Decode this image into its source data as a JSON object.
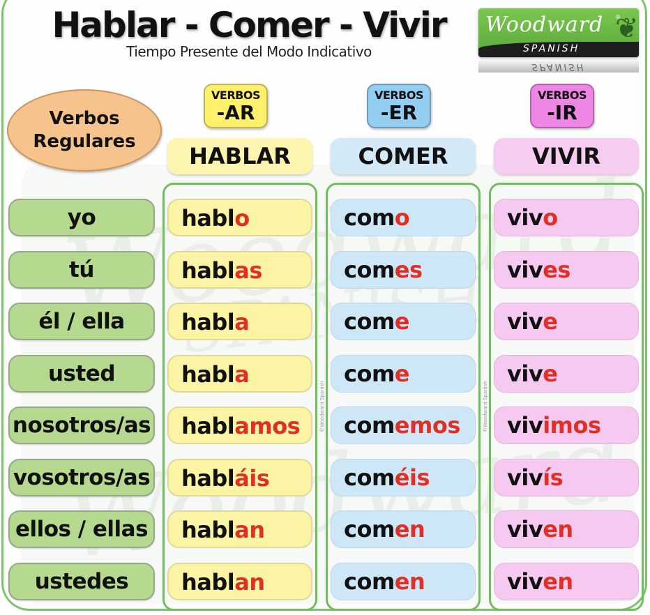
{
  "header": {
    "title": "Hablar - Comer - Vivir",
    "subtitle": "Tiempo Presente del Modo Indicativo"
  },
  "logo": {
    "brand": "Woodward",
    "registered": "®",
    "sub": "SPANISH",
    "reflection": "SPANISH"
  },
  "category": {
    "line1": "Verbos",
    "line2": "Regulares"
  },
  "colors": {
    "ar": "#fbf4a4",
    "er": "#cde7f6",
    "ir": "#f6c9f1",
    "pronoun": "#b5d98f",
    "ending": "#e03026",
    "border": "#6fbf5c"
  },
  "columns": [
    {
      "tag_top": "VERBOS",
      "tag_bottom": "-AR",
      "tag_color": "#fdf06b",
      "verb": "HABLAR",
      "verb_bg": "#fcf5b0",
      "copyright": "©Woodward Spanish"
    },
    {
      "tag_top": "VERBOS",
      "tag_bottom": "-ER",
      "tag_color": "#94cdf2",
      "verb": "COMER",
      "verb_bg": "#d3e9f7",
      "copyright": "©Woodward Spanish"
    },
    {
      "tag_top": "VERBOS",
      "tag_bottom": "-IR",
      "tag_color": "#ee86e4",
      "verb": "VIVIR",
      "verb_bg": "#f6cdf1"
    }
  ],
  "rows": [
    {
      "pronoun": "yo",
      "ar": [
        "habl",
        "o"
      ],
      "er": [
        "com",
        "o"
      ],
      "ir": [
        "viv",
        "o"
      ]
    },
    {
      "pronoun": "tú",
      "ar": [
        "habl",
        "as"
      ],
      "er": [
        "com",
        "es"
      ],
      "ir": [
        "viv",
        "es"
      ]
    },
    {
      "pronoun": "él / ella",
      "ar": [
        "habl",
        "a"
      ],
      "er": [
        "com",
        "e"
      ],
      "ir": [
        "viv",
        "e"
      ]
    },
    {
      "pronoun": "usted",
      "ar": [
        "habl",
        "a"
      ],
      "er": [
        "com",
        "e"
      ],
      "ir": [
        "viv",
        "e"
      ]
    },
    {
      "pronoun": "nosotros/as",
      "ar": [
        "habl",
        "amos"
      ],
      "er": [
        "com",
        "emos"
      ],
      "ir": [
        "viv",
        "imos"
      ]
    },
    {
      "pronoun": "vosotros/as",
      "ar": [
        "habl",
        "áis"
      ],
      "er": [
        "com",
        "éis"
      ],
      "ir": [
        "viv",
        "ís"
      ]
    },
    {
      "pronoun": "ellos / ellas",
      "ar": [
        "habl",
        "an"
      ],
      "er": [
        "com",
        "en"
      ],
      "ir": [
        "viv",
        "en"
      ]
    },
    {
      "pronoun": "ustedes",
      "ar": [
        "habl",
        "an"
      ],
      "er": [
        "com",
        "en"
      ],
      "ir": [
        "viv",
        "en"
      ]
    }
  ]
}
